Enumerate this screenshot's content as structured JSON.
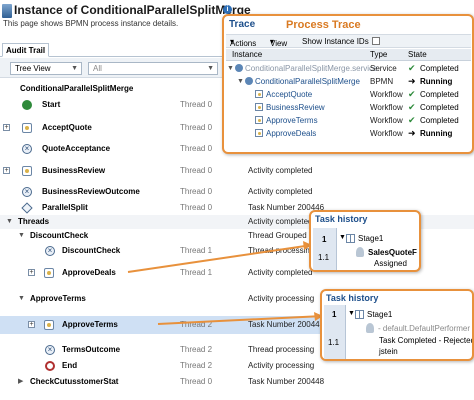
{
  "header": {
    "title": "Instance of ConditionalParallelSplitMerge",
    "subtitle": "This page shows BPMN process instance details."
  },
  "tabs": {
    "audit_trail": "Audit Trail"
  },
  "toolbar": {
    "view_select": "Tree View",
    "filter_select": "All"
  },
  "rows": [
    {
      "name": "ConditionalParallelSplitMerge",
      "thread": "",
      "status": ""
    },
    {
      "name": "Start",
      "thread": "Thread 0",
      "status": ""
    },
    {
      "name": "AcceptQuote",
      "thread": "Thread 0",
      "status": ""
    },
    {
      "name": "QuoteAcceptance",
      "thread": "Thread 0",
      "status": ""
    },
    {
      "name": "BusinessReview",
      "thread": "Thread 0",
      "status": "Activity completed"
    },
    {
      "name": "BusinessReviewOutcome",
      "thread": "Thread 0",
      "status": "Activity completed"
    },
    {
      "name": "ParallelSplit",
      "thread": "Thread 0",
      "status": "Task Number  200446"
    },
    {
      "name": "Threads",
      "thread": "",
      "status": "Activity completed"
    },
    {
      "name": "DiscountCheck",
      "thread": "",
      "status": "Thread Grouped"
    },
    {
      "name": "DiscountCheck",
      "thread": "Thread 1",
      "status": "Thread processing"
    },
    {
      "name": "ApproveDeals",
      "thread": "Thread 1",
      "status": "Activity completed"
    },
    {
      "name": "ApproveTerms",
      "thread": "",
      "status": "Activity processing"
    },
    {
      "name": "ApproveTerms",
      "thread": "Thread 2",
      "status": "Task Number  200448"
    },
    {
      "name": "TermsOutcome",
      "thread": "Thread 2",
      "status": "Thread processing"
    },
    {
      "name": "End",
      "thread": "Thread 2",
      "status": "Activity processing"
    },
    {
      "name": "CheckCutusstomerStat",
      "thread": "Thread 0",
      "status": "Task Number  200448"
    }
  ],
  "trace": {
    "title": "Trace",
    "annotation": "Process Trace",
    "actions": "Actions",
    "view": "View",
    "show_instance_ids": "Show Instance IDs",
    "columns": {
      "instance": "Instance",
      "type": "Type",
      "state": "State"
    },
    "rows": [
      {
        "instance": "ConditionalParallelSplitMerge.service",
        "type": "Service",
        "state": "Completed"
      },
      {
        "instance": "ConditionalParallelSplitMerge",
        "type": "BPMN",
        "state": "Running"
      },
      {
        "instance": "AcceptQuote",
        "type": "Workflow",
        "state": "Completed"
      },
      {
        "instance": "BusinessReview",
        "type": "Workflow",
        "state": "Completed"
      },
      {
        "instance": "ApproveTerms",
        "type": "Workflow",
        "state": "Completed"
      },
      {
        "instance": "ApproveDeals",
        "type": "Workflow",
        "state": "Running"
      }
    ]
  },
  "task_history_1": {
    "title": "Task history",
    "stage": "Stage1",
    "step_1": "1",
    "step_1_1": "1.1",
    "assignee": "SalesQuoteF",
    "status": "Assigned"
  },
  "task_history_2": {
    "title": "Task history",
    "stage": "Stage1",
    "step_1": "1",
    "step_1_1": "1.1",
    "performer": "- default.DefaultPerformer",
    "status": "Task Completed - Rejected",
    "user": "jstein"
  }
}
